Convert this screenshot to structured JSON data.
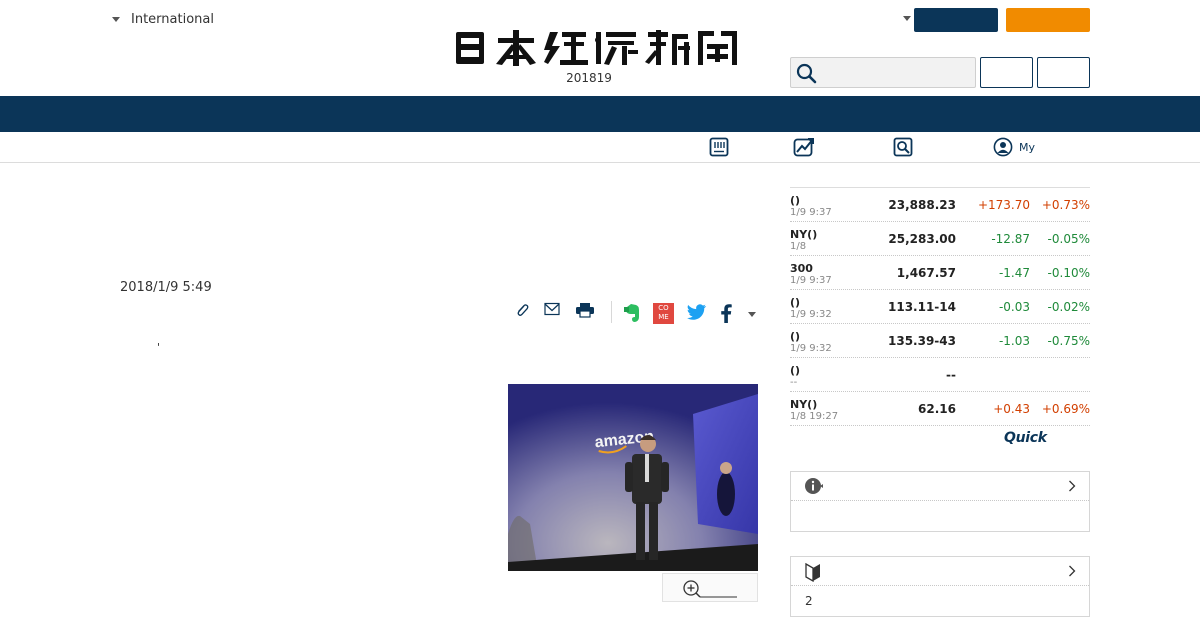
{
  "header": {
    "edition_label": "International",
    "date_line": "201819",
    "icons": [
      "chevron-down-icon",
      "search-icon"
    ],
    "colors": {
      "brand_navy": "#0b3558",
      "accent_orange": "#f18b00"
    }
  },
  "subnav": {
    "tools": [
      "newspaper-icon",
      "chart-icon",
      "search-doc-icon",
      "user-icon"
    ],
    "my_label": "My"
  },
  "article": {
    "published": "2018/1/9 5:49",
    "stray_mark": "'",
    "share_icons": [
      "clip-icon",
      "mail-icon",
      "print-icon",
      "evernote-icon",
      "come-icon",
      "twitter-icon",
      "facebook-icon",
      "chevron-down-icon"
    ],
    "come_label": "COME",
    "photo_caption_word": "amazon",
    "zoom_icon": "zoom-in-icon"
  },
  "market": {
    "rows": [
      {
        "name": "()",
        "time": "1/9 9:37",
        "value": "23,888.23",
        "change": "+173.70",
        "pct": "+0.73%",
        "dir": "up"
      },
      {
        "name": "NY()",
        "time": "1/8",
        "value": "25,283.00",
        "change": "-12.87",
        "pct": "-0.05%",
        "dir": "down"
      },
      {
        "name": "300",
        "time": "1/9 9:37",
        "value": "1,467.57",
        "change": "-1.47",
        "pct": "-0.10%",
        "dir": "down"
      },
      {
        "name": "()",
        "time": "1/9 9:32",
        "value": "113.11-14",
        "change": "-0.03",
        "pct": "-0.02%",
        "dir": "down"
      },
      {
        "name": "()",
        "time": "1/9 9:32",
        "value": "135.39-43",
        "change": "-1.03",
        "pct": "-0.75%",
        "dir": "down"
      },
      {
        "name": "()",
        "time": "--",
        "value": "--",
        "change": "",
        "pct": "",
        "dir": "none"
      },
      {
        "name": "NY()",
        "time": "1/8 19:27",
        "value": "62.16",
        "change": "+0.43",
        "pct": "+0.69%",
        "dir": "up"
      }
    ],
    "colors": {
      "up": "#d23f00",
      "down": "#1f8a3a"
    },
    "provider": "Quick"
  },
  "sidebox1": {
    "icon": "info-icon",
    "body": ""
  },
  "sidebox2": {
    "icon": "beginner-icon",
    "body": "2"
  }
}
